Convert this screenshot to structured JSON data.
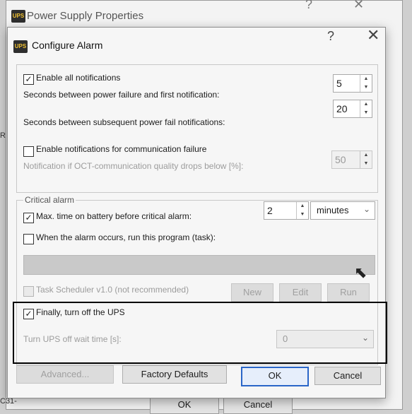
{
  "parent_window": {
    "title": "Power Supply Properties",
    "help_glyph": "?",
    "close_glyph": "✕",
    "ok_label": "OK",
    "cancel_label": "Cancel",
    "side_r": "R",
    "side_c31": "C31-"
  },
  "dialog": {
    "title": "Configure Alarm",
    "icon_text": "UPS",
    "help_glyph": "?",
    "close_glyph": "✕",
    "enable_all_label": "Enable all notifications",
    "seconds_first_label": "Seconds between power failure and first notification:",
    "seconds_first_value": "5",
    "seconds_subsequent_label": "Seconds between subsequent power fail notifications:",
    "seconds_subsequent_value": "20",
    "enable_comm_label": "Enable notifications for communication failure",
    "comm_quality_label": "Notification if OCT-communication quality drops below [%]:",
    "comm_quality_value": "50",
    "critical_group_label": "Critical alarm",
    "max_time_label": "Max. time on battery before critical alarm:",
    "max_time_value": "2",
    "max_time_unit": "minutes",
    "run_program_label": "When the alarm occurs, run this program (task):",
    "program_path": "",
    "task_scheduler_label": "Task Scheduler v1.0 (not recommended)",
    "new_label": "New",
    "edit_label": "Edit",
    "run_label": "Run",
    "turn_off_label": "Finally, turn off the UPS",
    "wait_time_label": "Turn UPS off wait time [s]:",
    "wait_time_value": "0",
    "advanced_label": "Advanced...",
    "factory_label": "Factory Defaults",
    "ok_label": "OK",
    "cancel_label": "Cancel",
    "checkmark": "✓",
    "spin_up": "▲",
    "spin_down": "▼",
    "chevron": "⌄"
  },
  "colors": {
    "highlight_border": "#000000",
    "ok_button_border": "#2a66c8",
    "ups_icon_bg": "#2e2e2e"
  }
}
